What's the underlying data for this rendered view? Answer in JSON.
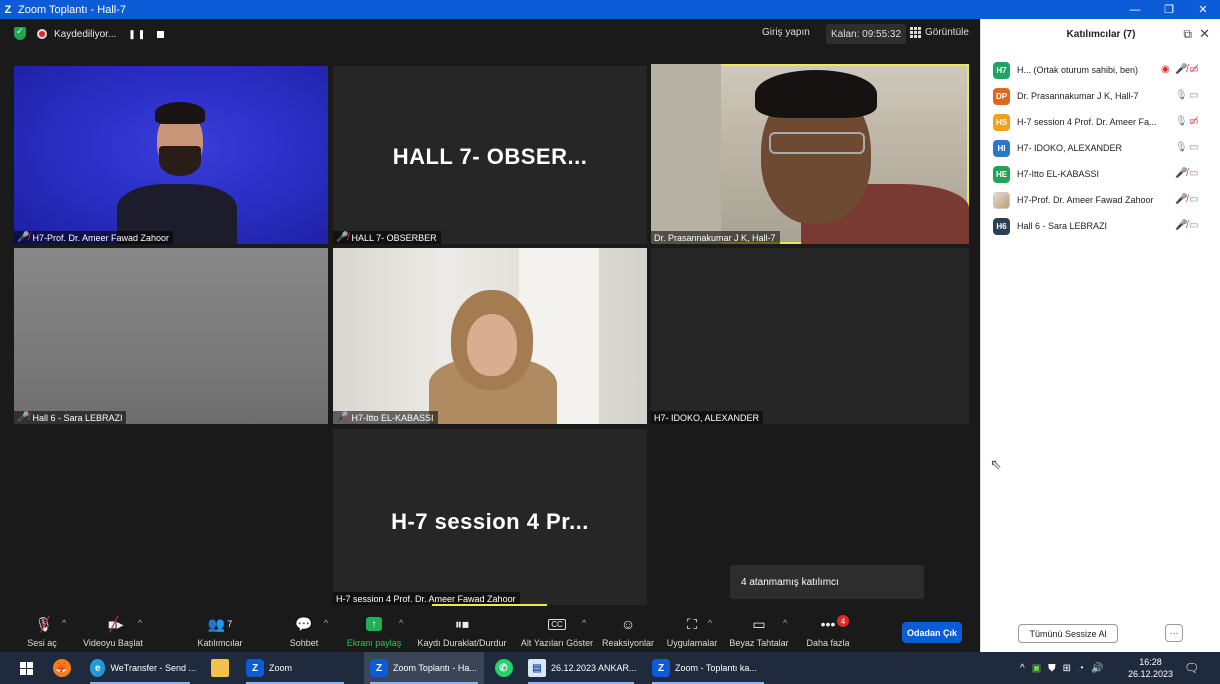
{
  "window": {
    "title": "Zoom Toplantı - Hall-7",
    "app_icon": "zoom-logo-icon"
  },
  "topbar": {
    "recording_label": "Kaydediliyor...",
    "signin": "Giriş yapın",
    "remaining": "Kalan: 09:55:32",
    "view": "Görüntüle"
  },
  "tiles": {
    "t1": {
      "label": "H7-Prof. Dr. Ameer Fawad Zahoor"
    },
    "t2": {
      "label": "HALL 7- OBSERBER",
      "big": "HALL 7- OBSER..."
    },
    "t3": {
      "label": "Dr. Prasannakumar J K, Hall-7"
    },
    "t4": {
      "label": "Hall 6 - Sara LEBRAZI"
    },
    "t5": {
      "label": "H7-Itto EL-KABASSI"
    },
    "t6": {
      "label": "H7- IDOKO, ALEXANDER"
    },
    "t7": {
      "label": "H-7 session 4 Prof. Dr. Ameer Fawad Zahoor",
      "big": "H-7 session 4 Pr..."
    }
  },
  "tooltip": "4 atanmamış katılımcı",
  "toolbar": {
    "audio": "Sesi aç",
    "video": "Videoyu Başlat",
    "participants": "Katılımcılar",
    "participants_count": "7",
    "chat": "Sohbet",
    "share": "Ekranı paylaş",
    "record": "Kaydı Duraklat/Durdur",
    "captions": "Alt Yazıları Göster",
    "reactions": "Reaksiyonlar",
    "apps": "Uygulamalar",
    "whiteboards": "Beyaz Tahtalar",
    "more": "Daha fazla",
    "more_badge": "4",
    "leave": "Odadan Çık"
  },
  "panel": {
    "title": "Katılımcılar (7)",
    "participants": [
      {
        "avatar": "H7",
        "color": "#1fa463",
        "name": "H... (Ortak oturum sahibi, ben)"
      },
      {
        "avatar": "DP",
        "color": "#e0681b",
        "name": "Dr. Prasannakumar J K, Hall-7"
      },
      {
        "avatar": "HS",
        "color": "#f0a01e",
        "name": "H-7 session 4 Prof. Dr. Ameer Fa..."
      },
      {
        "avatar": "HI",
        "color": "#2a78c9",
        "name": "H7- IDOKO, ALEXANDER"
      },
      {
        "avatar": "HE",
        "color": "#23a455",
        "name": "H7-Itto EL-KABASSI"
      },
      {
        "avatar": "",
        "color": "#c9a77c",
        "name": "H7-Prof. Dr. Ameer Fawad Zahoor"
      },
      {
        "avatar": "H6",
        "color": "#2d3f55",
        "name": "Hall 6 - Sara LEBRAZI"
      }
    ],
    "mute_all": "Tümünü Sessize Al",
    "more": "···"
  },
  "taskbar": {
    "items": [
      "WeTransfer - Send ...",
      "Zoom",
      "Zoom Toplantı - Ha...",
      "26.12.2023 ANKAR...",
      "Zoom - Toplantı ka..."
    ],
    "time": "16:28",
    "date": "26.12.2023"
  }
}
